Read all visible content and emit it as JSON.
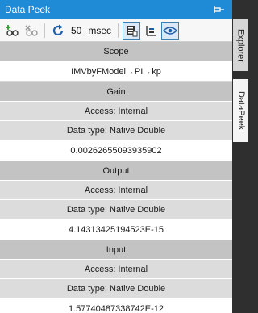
{
  "window": {
    "title": "Data Peek",
    "pin_icon": "pin-icon"
  },
  "toolbar": {
    "add_icon": "add-watch-icon",
    "remove_icon": "remove-watch-icon",
    "refresh_icon": "refresh-icon",
    "interval_value": "50",
    "interval_unit": "msec",
    "view_icon_1": "table-view-icon",
    "view_icon_2": "trend-view-icon",
    "view_icon_3": "eye-icon"
  },
  "rows": [
    {
      "kind": "header",
      "text": "Scope"
    },
    {
      "kind": "value",
      "text": "IMVbyFModel→PI→kp"
    },
    {
      "kind": "header",
      "text": "Gain"
    },
    {
      "kind": "meta",
      "text": "Access: Internal"
    },
    {
      "kind": "meta",
      "text": "Data type: Native Double"
    },
    {
      "kind": "value",
      "text": "0.00262655093935902"
    },
    {
      "kind": "header",
      "text": "Output"
    },
    {
      "kind": "meta",
      "text": "Access: Internal"
    },
    {
      "kind": "meta",
      "text": "Data type: Native Double"
    },
    {
      "kind": "value",
      "text": "4.14313425194523E-15"
    },
    {
      "kind": "header",
      "text": "Input"
    },
    {
      "kind": "meta",
      "text": "Access: Internal"
    },
    {
      "kind": "meta",
      "text": "Data type: Native Double"
    },
    {
      "kind": "value",
      "text": "1.57740487338742E-12"
    }
  ],
  "side_tabs": {
    "explorer": "Explorer",
    "datapeek": "DataPeek"
  },
  "colors": {
    "titlebar": "#1f8ad6",
    "header_row": "#c3c3c3",
    "meta_row": "#dcdcdc",
    "value_row": "#ffffff"
  }
}
